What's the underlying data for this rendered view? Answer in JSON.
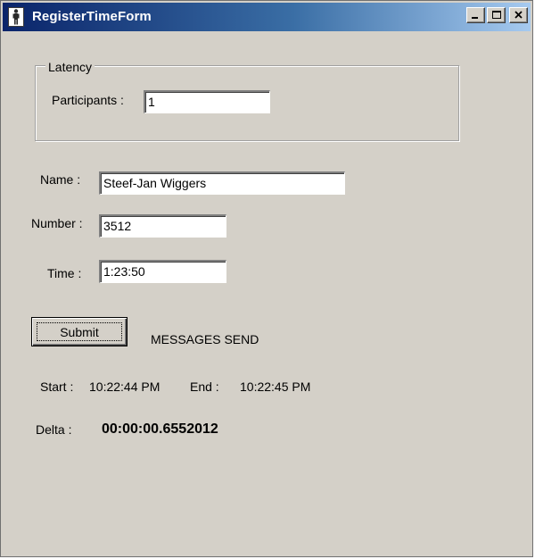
{
  "window": {
    "title": "RegisterTimeForm",
    "icon": "person-icon",
    "controls": {
      "minimize": "minimize-icon",
      "maximize": "maximize-icon",
      "close": "close-icon"
    }
  },
  "latency_group": {
    "title": "Latency",
    "participants_label": "Participants :",
    "participants_value": "1"
  },
  "form": {
    "name_label": "Name :",
    "name_value": "Steef-Jan Wiggers",
    "number_label": "Number :",
    "number_value": "3512",
    "time_label": "Time :",
    "time_value": "1:23:50"
  },
  "submit_label": "Submit",
  "status_text": "MESSAGES SEND",
  "timing": {
    "start_label": "Start :",
    "start_value": "10:22:44 PM",
    "end_label": "End :",
    "end_value": "10:22:45 PM",
    "delta_label": "Delta :",
    "delta_value": "00:00:00.6552012"
  },
  "colors": {
    "titlebar_start": "#0a246a",
    "titlebar_end": "#a6caf0",
    "window_bg": "#d4d0c8"
  }
}
